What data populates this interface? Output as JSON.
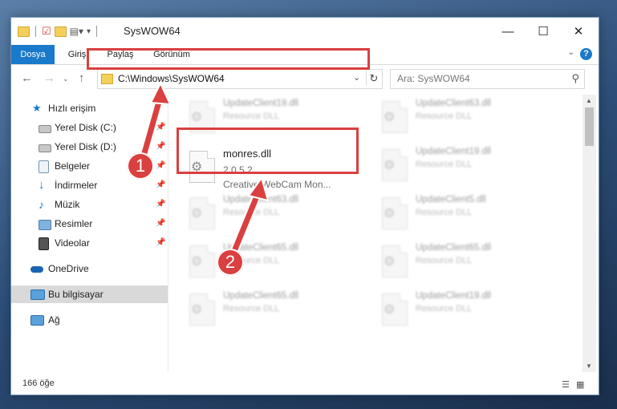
{
  "window": {
    "title": "SysWOW64",
    "controls": {
      "minimize": "—",
      "maximize": "☐",
      "close": "✕"
    }
  },
  "ribbon": {
    "tabs": [
      "Dosya",
      "Giriş",
      "Paylaş",
      "Görünüm"
    ],
    "help": "?"
  },
  "nav": {
    "address": "C:\\Windows\\SysWOW64",
    "search_placeholder": "Ara: SysWOW64"
  },
  "sidebar": {
    "items": [
      {
        "label": "Hızlı erişim",
        "icon": "star-icon",
        "pinned": false
      },
      {
        "label": "Yerel Disk (C:)",
        "icon": "disk-icon",
        "pinned": true
      },
      {
        "label": "Yerel Disk (D:)",
        "icon": "disk-icon",
        "pinned": true
      },
      {
        "label": "Belgeler",
        "icon": "documents-icon",
        "pinned": true
      },
      {
        "label": "İndirmeler",
        "icon": "download-icon",
        "pinned": true
      },
      {
        "label": "Müzik",
        "icon": "music-icon",
        "pinned": true
      },
      {
        "label": "Resimler",
        "icon": "pictures-icon",
        "pinned": true
      },
      {
        "label": "Videolar",
        "icon": "videos-icon",
        "pinned": true
      },
      {
        "label": "OneDrive",
        "icon": "cloud-icon",
        "pinned": false
      },
      {
        "label": "Bu bilgisayar",
        "icon": "computer-icon",
        "pinned": false,
        "selected": true
      },
      {
        "label": "Ağ",
        "icon": "network-icon",
        "pinned": false
      }
    ]
  },
  "files": {
    "left_column": [
      {
        "name": "UpdateClient19.dll",
        "type": "Resource DLL"
      },
      {
        "name": "UpdateClient63.dll",
        "type": "Resource DLL"
      },
      {
        "name": "UpdateClient65.dll",
        "type": "Resource DLL"
      },
      {
        "name": "UpdateClient65.dll",
        "type": "Resource DLL"
      }
    ],
    "right_column": [
      {
        "name": "UpdateClient63.dll",
        "type": "Resource DLL"
      },
      {
        "name": "UpdateClient19.dll",
        "type": "Resource DLL"
      },
      {
        "name": "UpdateClient5.dll",
        "type": "Resource DLL"
      },
      {
        "name": "UpdateClient65.dll",
        "type": "Resource DLL"
      },
      {
        "name": "UpdateClient19.dll",
        "type": "Resource DLL"
      }
    ],
    "highlighted": {
      "name": "monres.dll",
      "version": "2.0.5.2",
      "description": "Creative WebCam Mon..."
    }
  },
  "status": {
    "count": "166 öğe"
  },
  "annotations": {
    "step1": "1",
    "step2": "2"
  },
  "colors": {
    "accent": "#1979ca",
    "highlight": "#d9403f"
  }
}
